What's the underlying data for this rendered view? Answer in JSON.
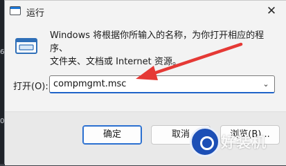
{
  "window": {
    "title": "运行",
    "close_glyph": "✕"
  },
  "description": {
    "line1": "Windows 将根据你所输入的名称，为你打开相应的程序、",
    "line2": "文件夹、文档或 Internet 资源。"
  },
  "open_field": {
    "label": "打开(O):",
    "value": "compmgmt.msc",
    "caret_glyph": "⌄"
  },
  "buttons": {
    "ok": "确定",
    "cancel": "取消",
    "browse": "浏览(B)..."
  },
  "desktop_edge": [
    "6",
    "0"
  ],
  "watermark": {
    "text": "好装机"
  },
  "colors": {
    "accent": "#1e63c8",
    "arrow": "#e53935",
    "watermark_blue": "#1c4fb6"
  },
  "icons": {
    "title": "run-dialog-icon",
    "app": "run-app-icon",
    "close": "close-icon",
    "dropdown": "chevron-down-icon",
    "watermark": "watermark-logo-icon"
  }
}
